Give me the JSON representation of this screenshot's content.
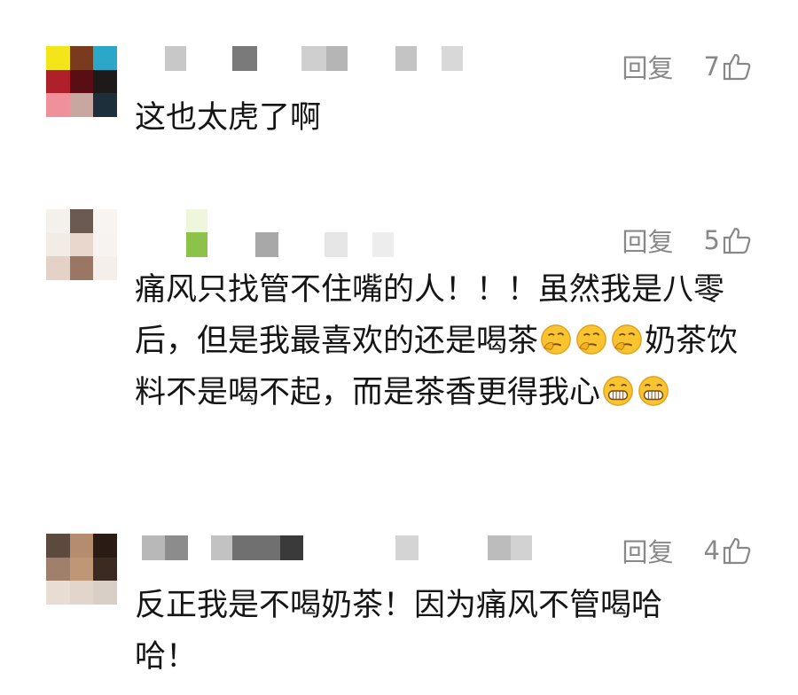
{
  "comments": [
    {
      "reply_label": "回复",
      "like_count": "7",
      "text": "这也太虎了啊",
      "avatar_colors": [
        "#f2e61a",
        "#7a3a1e",
        "#2aa7c9",
        "#b0202a",
        "#5a0d14",
        "#1e1a1a",
        "#f0909a",
        "#c8a7a0",
        "#1c2f3a"
      ],
      "name_colors": [
        "#c8c8c8",
        "#7a7a7a",
        "#cfcfcf",
        "#b5b5b5",
        "#c4c4c4",
        "#d8d8d8"
      ]
    },
    {
      "reply_label": "回复",
      "like_count": "5",
      "text_parts": [
        "痛风只找管不住嘴的人！！！虽然我是八零后，但是我最喜欢的还是喝茶",
        "奶茶饮料不是喝不起，而是茶香更得我心"
      ],
      "emoji_thinking": "thinking-face-emoji",
      "emoji_grin": "grinning-face-emoji",
      "avatar_colors": [
        "#f4f0ec",
        "#6b5a52",
        "#f7f4f1",
        "#f2ece6",
        "#e9d6cc",
        "#f6f3f1",
        "#e5d2c6",
        "#9a7664",
        "#f4efea"
      ],
      "name_colors": [
        "#eef6dc",
        "#8cc24a",
        "#a8a8a8",
        "#e6e6e6",
        "#ededed"
      ]
    },
    {
      "reply_label": "回复",
      "like_count": "4",
      "text": "反正我是不喝奶茶！因为痛风不管喝哈哈！",
      "avatar_colors": [
        "#5c4a3e",
        "#b58d6e",
        "#2a1c14",
        "#a0806a",
        "#bf9676",
        "#3a2a22",
        "#e8ddd3",
        "#e2d6cc",
        "#d8cfc6"
      ],
      "name_colors": [
        "#b8b8b8",
        "#8c8c8c",
        "#c2c2c2",
        "#707070",
        "#3a3a3a",
        "#d4d4d4",
        "#bcbcbc",
        "#d2d2d2"
      ]
    }
  ]
}
